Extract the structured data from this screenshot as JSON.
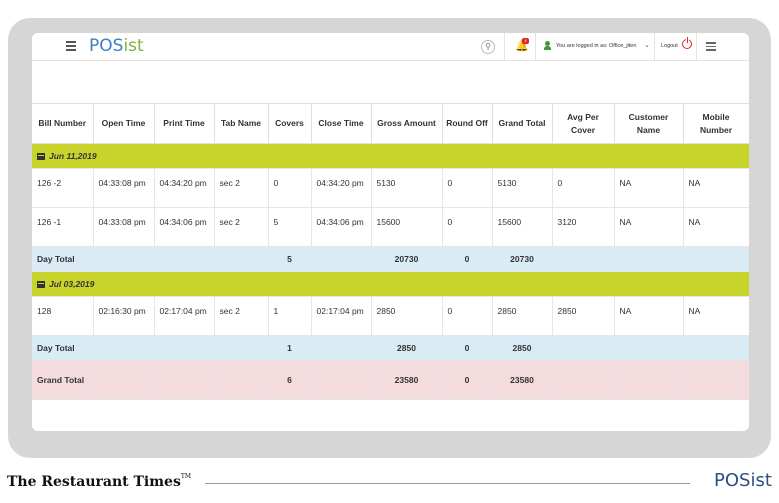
{
  "header": {
    "logo_pos": "POS",
    "logo_ist": "ist",
    "notification_count": "4",
    "user_text": "You are logged in as: Office_jiten",
    "logout_label": "Logout"
  },
  "table": {
    "columns": [
      "Bill Number",
      "Open Time",
      "Print Time",
      "Tab Name",
      "Covers",
      "Close Time",
      "Gross Amount",
      "Round Off",
      "Grand Total",
      "Avg Per Cover",
      "Customer Name",
      "Mobile Number"
    ],
    "groups": [
      {
        "date": "Jun 11,2019",
        "rows": [
          [
            "126 -2",
            "04:33:08 pm",
            "04:34:20 pm",
            "sec 2",
            "0",
            "04:34:20 pm",
            "5130",
            "0",
            "5130",
            "0",
            "NA",
            "NA"
          ],
          [
            "126 -1",
            "04:33:08 pm",
            "04:34:06 pm",
            "sec 2",
            "5",
            "04:34:06 pm",
            "15600",
            "0",
            "15600",
            "3120",
            "NA",
            "NA"
          ]
        ],
        "total": {
          "label": "Day Total",
          "covers": "5",
          "gross": "20730",
          "round_off": "0",
          "grand": "20730"
        }
      },
      {
        "date": "Jul 03,2019",
        "rows": [
          [
            "128",
            "02:16:30 pm",
            "02:17:04 pm",
            "sec 2",
            "1",
            "02:17:04 pm",
            "2850",
            "0",
            "2850",
            "2850",
            "NA",
            "NA"
          ]
        ],
        "total": {
          "label": "Day Total",
          "covers": "1",
          "gross": "2850",
          "round_off": "0",
          "grand": "2850"
        }
      }
    ],
    "grand_total": {
      "label": "Grand Total",
      "covers": "6",
      "gross": "23580",
      "round_off": "0",
      "grand": "23580"
    }
  },
  "footer": {
    "publication": "The Restaurant Times",
    "trademark": "TM",
    "logo_pos": "POS",
    "logo_ist": "ist"
  },
  "colors": {
    "date_row": "#c8d42c",
    "day_total_row": "#d9ebf5",
    "grand_total_row": "#f4dcde",
    "logo_blue": "#3b7fc4",
    "logo_green": "#7db53a"
  }
}
